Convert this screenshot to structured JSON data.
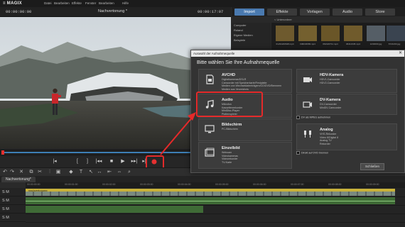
{
  "app": {
    "logo": "≡ MAGIX"
  },
  "menu": [
    "Datei",
    "Bearbeiten",
    "Effekte",
    "Fenster",
    "Bearbeiten",
    "Hilfe"
  ],
  "preview": {
    "timecode_left": "00:00:00:00",
    "title": "Nachvertonung *",
    "timecode_right": "00:00:17:07"
  },
  "right_tabs": [
    {
      "label": "Import",
      "active": true
    },
    {
      "label": "Effekte",
      "active": false
    },
    {
      "label": "Vorlagen",
      "active": false
    },
    {
      "label": "Audio",
      "active": false
    },
    {
      "label": "Store",
      "active": false
    }
  ],
  "browser": {
    "path": "< Unterordner",
    "sidebar": [
      "Computer",
      "Roland",
      "Eigene Medien",
      "Beispiele"
    ],
    "thumbs": [
      "01234220648.mp4",
      "048234683.mp4",
      "062320711.mp4",
      "06412345.mp4",
      "1234600.jpg",
      "6721200.jpg"
    ]
  },
  "dialog": {
    "title": "Auswahl der Aufnahmequelle",
    "heading": "Bitte wählen Sie Ihre Aufnahmequelle",
    "options_left": [
      {
        "title": "AVCHD",
        "desc": "Digitalkameras/DSLR\nCamcorder mit Speicherkarte/Festplatte\nMedien von Wechseldatenträgern/CD/DVD/Brennern\nMedien aus Verzeichnis"
      },
      {
        "title": "Audio",
        "desc": "Mikrofon\nKassettenrekorder\nMiniDisc-Player\nPlattenspieler"
      },
      {
        "title": "Bildschirm",
        "desc": "PC-Bildschirm"
      },
      {
        "title": "Einzelbild",
        "desc": "Webcam\nVideokameras\nVideorekorder\nTV-Karte"
      }
    ],
    "options_right": [
      {
        "title": "HDV-Kamera",
        "desc": "HDV1-Camcorder\nHDV2-Camcorder"
      },
      {
        "title": "DV-Kamera",
        "desc": "DV-Camcorder\nMiniDV-Camcorder"
      },
      {
        "title": "Analog",
        "desc": "VHS-Rekorder\nVideo 8/Digital 8\nAnalog TV\nRekorder"
      }
    ],
    "checkbox_dv": "DV als MPEG aufnehmen",
    "checkbox_dvd": "Direkt auf DVD brennen",
    "close_label": "Schließen"
  },
  "timeline": {
    "tab": "Nachvertonung*",
    "track_labels": [
      "S M",
      "S M",
      "S M",
      "S M"
    ],
    "clip_label": "nachvertonung",
    "ruler_marks": [
      "00:00:00:00",
      "00:00:01:00",
      "00:00:02:00",
      "00:00:03:00",
      "00:00:04:00",
      "00:00:05:00",
      "00:00:06:00",
      "00:00:07:00",
      "00:00:08:00",
      "00:00:09:00"
    ]
  },
  "colors": {
    "accent": "#4a7ab0",
    "highlight": "#e52a2a",
    "record": "#e53030"
  }
}
